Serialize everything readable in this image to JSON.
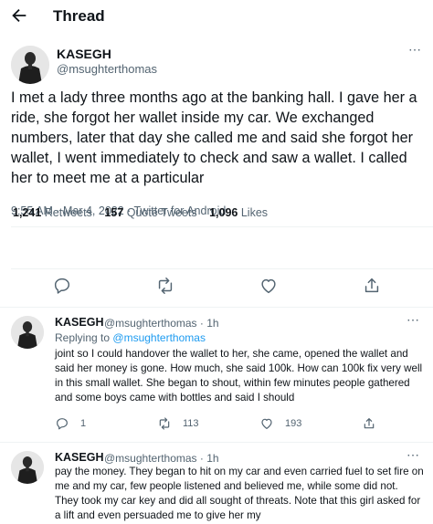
{
  "header": {
    "title": "Thread"
  },
  "tweet": {
    "author_name": "KASEGH",
    "author_handle": "@msughterthomas",
    "text": "I met a lady three months ago at the banking hall. I gave her a ride, she forgot her wallet inside my car. We exchanged numbers, later that day she called me and said she forgot her wallet, I went immediately to check and saw a wallet. I called her to meet me at a particular",
    "meta": "9:55 AM · Mar 4, 2022 · Twitter for Android",
    "stats": [
      {
        "value": "1,241",
        "label": "Retweets"
      },
      {
        "value": "157",
        "label": "Quote Tweets"
      },
      {
        "value": "1,096",
        "label": "Likes"
      }
    ],
    "actions": [
      "reply-icon",
      "retweet-icon",
      "like-icon",
      "share-icon"
    ]
  },
  "replies": [
    {
      "author_name": "KASEGH",
      "author_handle": "@msughterthomas · 1h",
      "replying_prefix": "Replying to",
      "replying_mention": "@msughterthomas",
      "text": "joint so I could handover the wallet to her, she came, opened the wallet and said her money is gone. How much, she said 100k. How can 100k fix very well in this small wallet. She began to shout, within few minutes people gathered and some boys came with bottles and said I should",
      "reply_count": "1",
      "retweet_count": "113",
      "like_count": "193"
    },
    {
      "author_name": "KASEGH",
      "author_handle": "@msughterthomas · 1h",
      "text": "pay the money. They began to hit on my car and even carried fuel to set fire on me and my car, few people listened and believed me, while some did not. They took my car key and did all sought of threats. Note that this girl asked for a lift and even persuaded me to give her my"
    }
  ],
  "colors": {
    "accent": "#1d9bf0",
    "text": "#0f1419",
    "secondary": "#536471",
    "divider": "#eff3f4"
  }
}
